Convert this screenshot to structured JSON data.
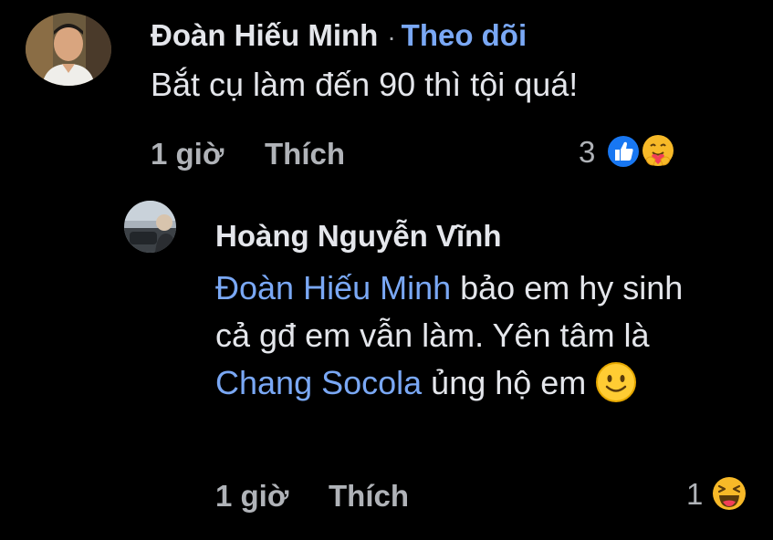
{
  "comment1": {
    "author": "Đoàn Hiếu Minh",
    "separator": "·",
    "follow_label": "Theo dõi",
    "text": "Bắt cụ làm đến 90 thì tội quá!",
    "time": "1 giờ",
    "like_label": "Thích",
    "reaction_count": "3",
    "reactions": [
      "like-icon",
      "care-icon"
    ]
  },
  "comment2": {
    "author": "Hoàng Nguyễn Vĩnh",
    "mention1": "Đoàn Hiếu Minh",
    "text_part1": " bảo em hy sinh cả gđ em vẫn làm. Yên tâm là ",
    "mention2": "Chang Socola",
    "text_part2": " ủng hộ em ",
    "inline_emoji": "smiling-face-icon",
    "time": "1 giờ",
    "like_label": "Thích",
    "reaction_count": "1",
    "reactions": [
      "haha-icon"
    ]
  },
  "colors": {
    "background": "#000000",
    "text": "#e4e6eb",
    "secondary": "#b0b3b8",
    "link": "#7aa8f5",
    "like_blue": "#1877f2",
    "emoji_yellow": "#f7b928"
  }
}
